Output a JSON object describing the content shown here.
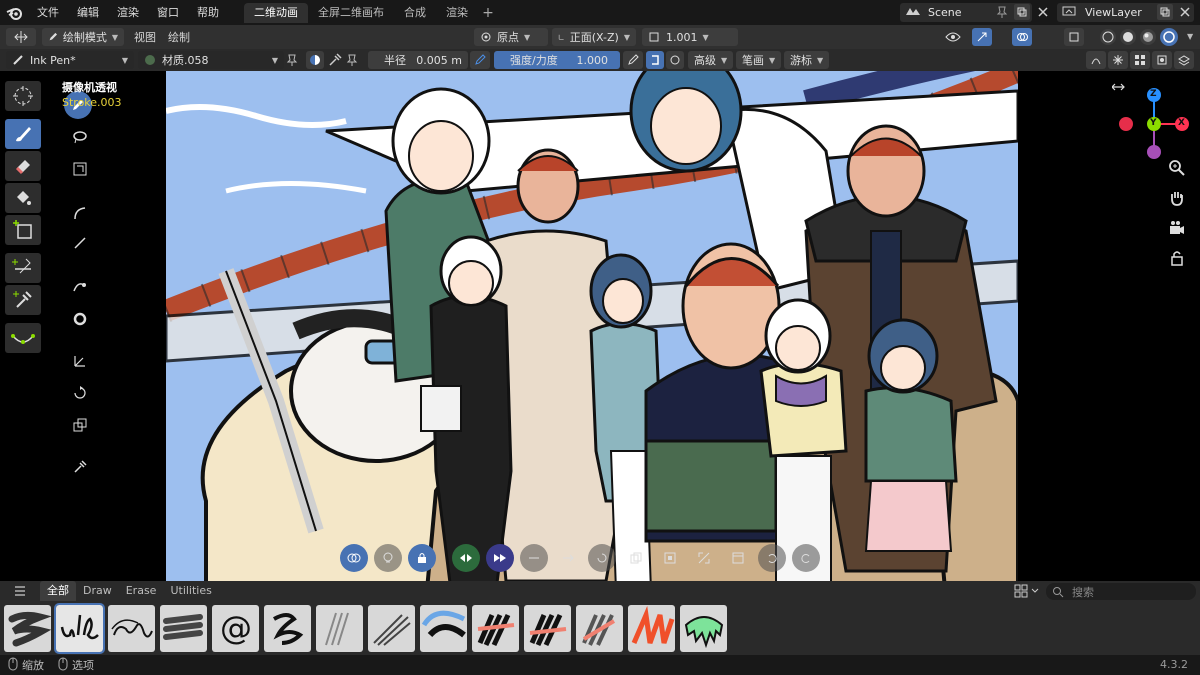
{
  "topbar": {
    "menu": [
      "文件",
      "编辑",
      "渲染",
      "窗口",
      "帮助"
    ],
    "workspaces": [
      "二维动画",
      "全屏二维画布",
      "合成",
      "渲染"
    ],
    "active_workspace": "二维动画",
    "scene": "Scene",
    "view_layer": "ViewLayer"
  },
  "header1": {
    "mode": "绘制模式",
    "view": "视图",
    "draw": "绘制",
    "origin": "原点",
    "plane": "正面(X-Z)",
    "value": "1.001"
  },
  "header2": {
    "brush": "Ink Pen*",
    "material": "材质.058",
    "radius_label": "半径",
    "radius_value": "0.005 m",
    "strength_label": "强度/力度",
    "strength_value": "1.000",
    "advanced": "高级",
    "stroke": "笔画",
    "cursor": "游标"
  },
  "viewport": {
    "camera_label": "摄像机透视",
    "object_label": "Stroke.003"
  },
  "gizmo": {
    "z": "Z",
    "y": "Y",
    "x": "X"
  },
  "asset_shelf": {
    "tabs": [
      "全部",
      "Draw",
      "Erase",
      "Utilities"
    ],
    "active_tab": "全部",
    "search_placeholder": "搜索"
  },
  "status": {
    "zoom": "缩放",
    "select": "选项",
    "version": "4.3.2"
  },
  "colors": {
    "accent": "#4772b3",
    "sky": "#9dbfef",
    "gizmo_x": "#ff3352",
    "gizmo_y": "#8bdc00",
    "gizmo_z": "#2890ff"
  }
}
